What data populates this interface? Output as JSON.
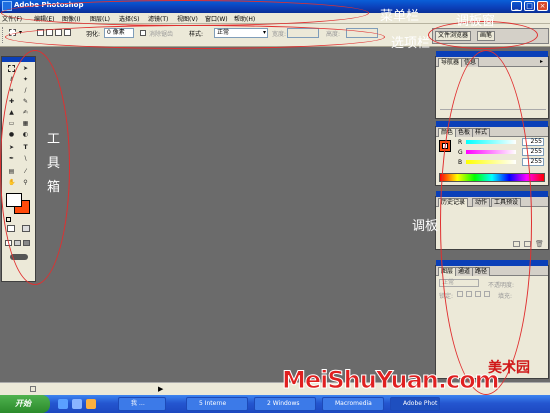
{
  "window": {
    "title": "Adobe Photoshop"
  },
  "menubar": {
    "items": [
      "文件(F)",
      "编辑(E)",
      "图像(I)",
      "图层(L)",
      "选择(S)",
      "滤镜(T)",
      "视图(V)",
      "窗口(W)",
      "帮助(H)"
    ]
  },
  "options": {
    "feather_label": "羽化:",
    "feather_value": "0 像素",
    "antialias_label": "消除锯齿",
    "style_label": "样式:",
    "style_value": "正常",
    "width_label": "宽度:",
    "height_label": "高度:"
  },
  "palette_well": {
    "tabs": [
      "文件浏览器",
      "画笔"
    ]
  },
  "panels": {
    "navigator": {
      "tabs": [
        "导航器",
        "信息"
      ]
    },
    "color": {
      "tabs": [
        "颜色",
        "色板",
        "样式"
      ],
      "channels": [
        {
          "label": "R",
          "value": "255"
        },
        {
          "label": "G",
          "value": "255"
        },
        {
          "label": "B",
          "value": "255"
        }
      ]
    },
    "history": {
      "tabs": [
        "历史记录",
        "动作",
        "工具预设"
      ]
    },
    "layers": {
      "tabs": [
        "图层",
        "通道",
        "路径"
      ],
      "mode": "正常",
      "opacity_label": "不透明度:",
      "lock_label": "锁定:",
      "fill_label": "填充:"
    }
  },
  "colors": {
    "foreground": "#ffffff",
    "background": "#ff4a0a",
    "accent": "#e03030"
  },
  "annotations": {
    "menubar": "菜单栏",
    "palette_well": "调板窗",
    "options": "选项栏",
    "toolbox": [
      "工",
      "具",
      "箱"
    ],
    "panels": "调板"
  },
  "taskbar": {
    "start": "开始",
    "tasks": [
      "我 …",
      "5 Interne",
      "2 Windows",
      "Macromedia",
      "Adobe Phot"
    ]
  },
  "watermark": {
    "brand": "美术园",
    "domain": "MeiShuYuan.com"
  }
}
